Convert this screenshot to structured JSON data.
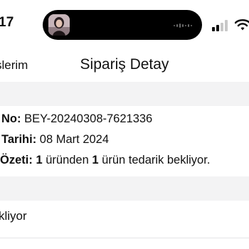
{
  "status_bar": {
    "time": "17"
  },
  "nav": {
    "back_label": "şlerim",
    "title": "Sipariş Detay"
  },
  "order": {
    "number_key": "No:",
    "number_value": "BEY-20240308-7621336",
    "date_key": "Tarihi:",
    "date_value": "08 Mart 2024",
    "summary_key": "Özeti:",
    "summary_count_1": "1",
    "summary_mid": "üründen",
    "summary_count_2": "1",
    "summary_rest": "ürün tedarik bekliyor."
  },
  "status_section": {
    "label": "kliyor"
  },
  "icons": {
    "island_thumbnail": "profile-thumbnail",
    "island_wave": "audio-wave-icon",
    "signal": "cellular-signal-icon",
    "wifi": "wifi-icon"
  }
}
